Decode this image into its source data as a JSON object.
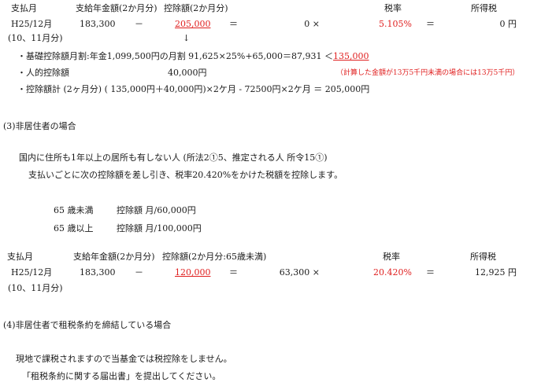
{
  "table1": {
    "headers": {
      "month": "支払月",
      "pension": "支給年金額(2か月分)",
      "deduction": "控除額(2か月分)",
      "rate": "税率",
      "tax": "所得税"
    },
    "row": {
      "month": "H25/12月",
      "pension": "183,300",
      "minus": "－",
      "deduction": "205,000",
      "equals1": "＝",
      "taxable": "0 ×",
      "rate": "5.105%",
      "equals2": "＝",
      "tax": "0 円"
    },
    "note": "(10、11月分)",
    "arrow": "↓"
  },
  "calc": {
    "line1_prefix": "・基礎控除額月割:年金1,099,500円の月割 91,625×25%+65,000＝87,931 ＜",
    "line1_value": "135,000",
    "line2_label": "・人的控除額",
    "line2_value": "40,000円",
    "line2_note": "（計算した金額が13万5千円未満の場合には13万5千円）",
    "line3": "・控除額計 (2ヶ月分) ( 135,000円＋40,000円)×2ケ月 - 72500円×2ケ月 ＝ 205,000円"
  },
  "section3": {
    "heading": "(3)非居住者の場合",
    "definition": "国内に住所も1年以上の居所も有しない人 (所法2①5、推定される人 所令15①)",
    "explanation": "支払いごとに次の控除額を差し引き、税率20.420%をかけた税額を控除します。",
    "under65_age": "65 歳未満",
    "under65_label": "控除額 月/60,000円",
    "over65_age": "65 歳以上",
    "over65_label": "控除額 月/100,000円"
  },
  "table2": {
    "headers": {
      "month": "支払月",
      "pension": "支給年金額(2か月分)",
      "deduction": "控除額(2か月分:65歳未満)",
      "rate": "税率",
      "tax": "所得税"
    },
    "row": {
      "month": "H25/12月",
      "pension": "183,300",
      "minus": "－",
      "deduction": "120,000",
      "equals1": "＝",
      "taxable": "63,300 ×",
      "rate": "20.420%",
      "equals2": "＝",
      "tax": "12,925 円"
    },
    "note": "(10、11月分)"
  },
  "section4": {
    "heading": "(4)非居住者で租税条約を締結している場合",
    "line1": "現地で課税されますので当基金では税控除をしません。",
    "line2": "「租税条約に関する届出書」を提出してください。"
  },
  "colors": {
    "accent_red": "#e02020",
    "text": "#1a1a1a"
  }
}
